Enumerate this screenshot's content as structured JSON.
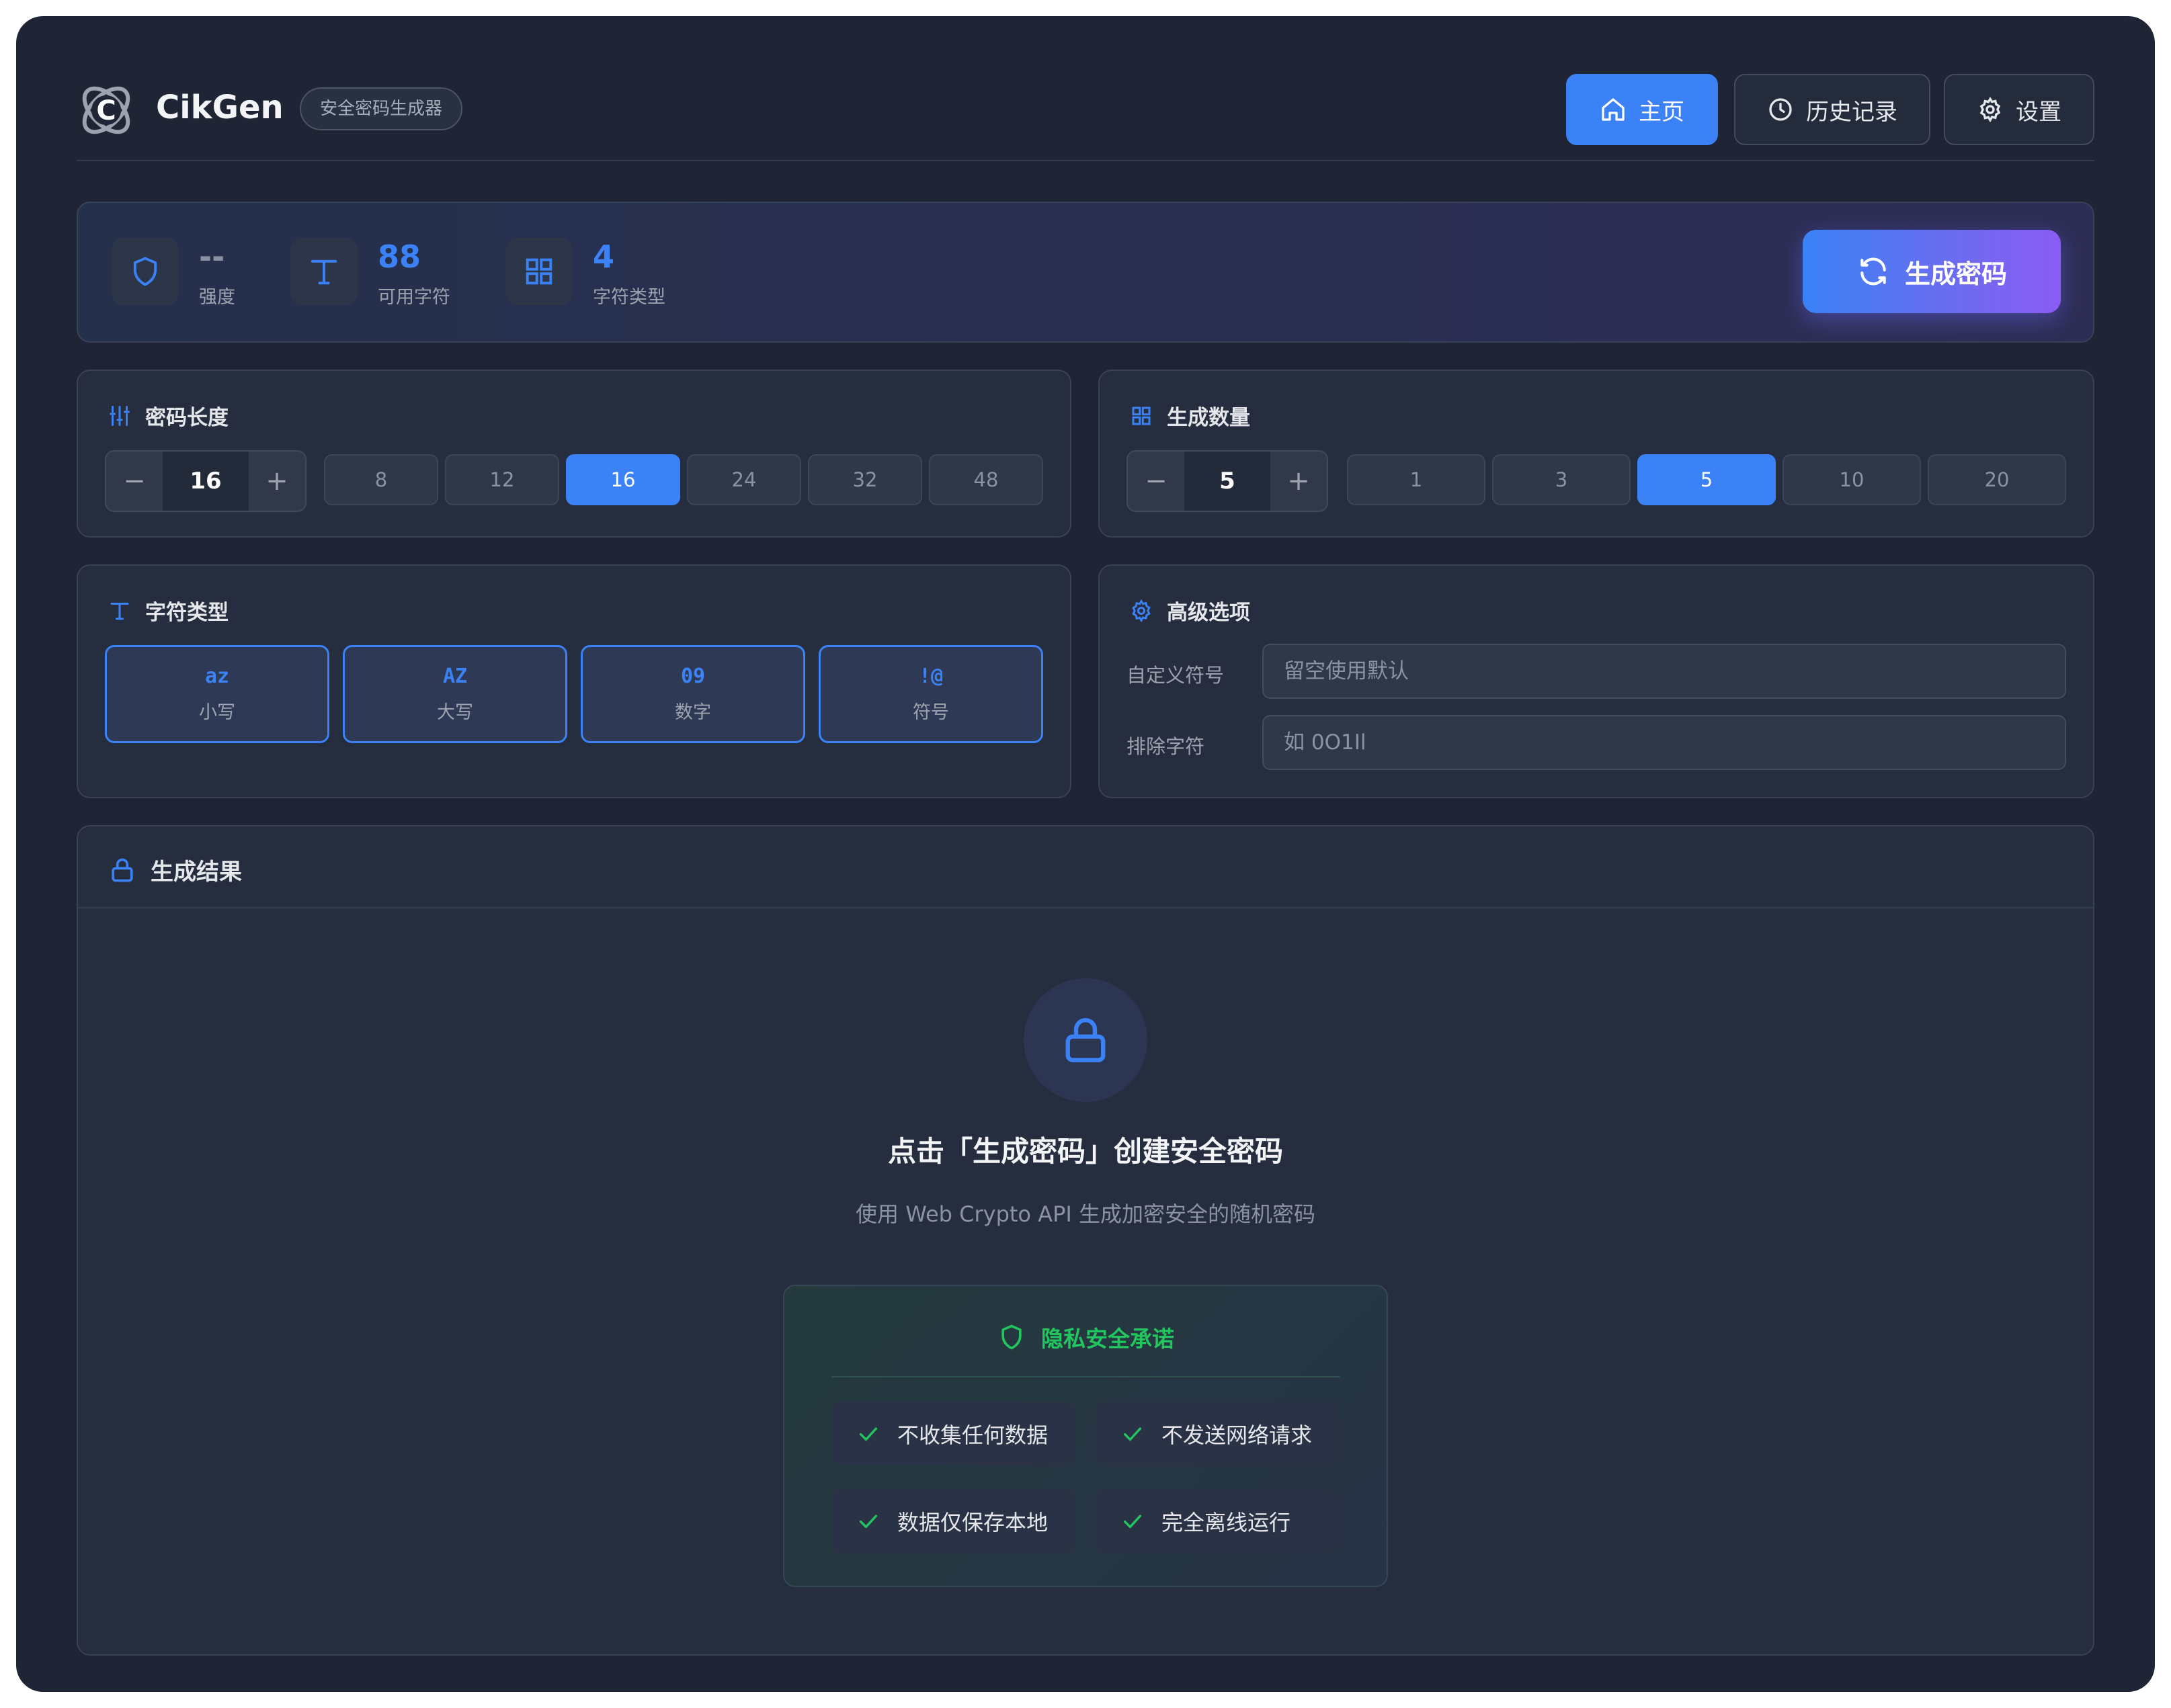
{
  "app": {
    "brand": "CikGen",
    "badge": "安全密码生成器"
  },
  "nav": {
    "home": "主页",
    "history": "历史记录",
    "settings": "设置",
    "active": "home"
  },
  "stats": [
    {
      "icon": "shield-icon",
      "value": "--",
      "label": "强度"
    },
    {
      "icon": "type-icon",
      "value": "88",
      "label": "可用字符"
    },
    {
      "icon": "grid-icon",
      "value": "4",
      "label": "字符类型"
    }
  ],
  "generate_label": "生成密码",
  "length": {
    "title": "密码长度",
    "decrement": "−",
    "increment": "+",
    "value": "16",
    "presets": [
      "8",
      "12",
      "16",
      "24",
      "32",
      "48"
    ],
    "active_preset": "16"
  },
  "count": {
    "title": "生成数量",
    "decrement": "−",
    "increment": "+",
    "value": "5",
    "presets": [
      "1",
      "3",
      "5",
      "10",
      "20"
    ],
    "active_preset": "5"
  },
  "char_types": {
    "title": "字符类型",
    "items": [
      {
        "code": "az",
        "label": "小写",
        "selected": true
      },
      {
        "code": "AZ",
        "label": "大写",
        "selected": true
      },
      {
        "code": "09",
        "label": "数字",
        "selected": true
      },
      {
        "code": "!@",
        "label": "符号",
        "selected": true
      }
    ]
  },
  "advanced": {
    "title": "高级选项",
    "custom_symbols": {
      "label": "自定义符号",
      "value": "",
      "placeholder": "留空使用默认"
    },
    "exclude_chars": {
      "label": "排除字符",
      "value": "",
      "placeholder": "如 0O1Il"
    }
  },
  "results": {
    "title": "生成结果",
    "empty_title": "点击「生成密码」创建安全密码",
    "empty_subtitle": "使用 Web Crypto API 生成加密安全的随机密码",
    "privacy": {
      "title": "隐私安全承诺",
      "items": [
        "不收集任何数据",
        "不发送网络请求",
        "数据仅保存本地",
        "完全离线运行"
      ]
    }
  },
  "colors": {
    "background": "#1f2535",
    "card": "#262d3f",
    "accent": "#3b82f6",
    "accent_gradient_end": "#8b5cf6",
    "success": "#22c55e"
  }
}
